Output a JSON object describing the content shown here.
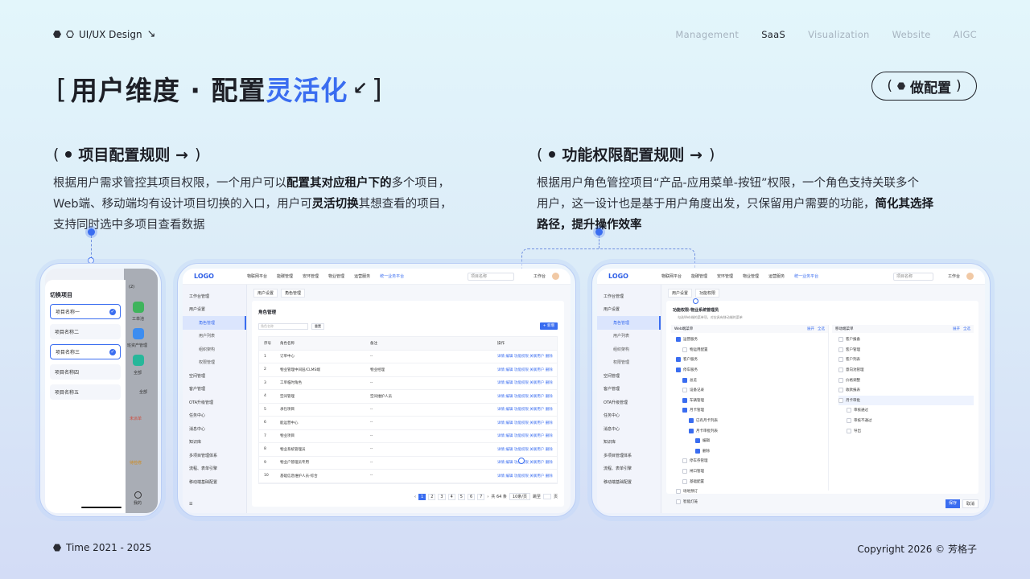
{
  "header": {
    "brand": "UI/UX Design",
    "brand_arrow": "↘",
    "nav": [
      "Management",
      "SaaS",
      "Visualization",
      "Website",
      "AIGC"
    ],
    "nav_active": "SaaS"
  },
  "title": {
    "part1": "用户维度 · 配置",
    "highlight": "灵活化",
    "bracket_left": "[",
    "bracket_right": "]",
    "corner_arrow": "↙"
  },
  "config_button": {
    "label": "做配置"
  },
  "section_left": {
    "heading": "项目配置规则 →",
    "p1_a": "根据用户需求管控其项目权限，一个用户可以",
    "p1_b": "配置其对应租户下的",
    "p1_c": "多个项目，",
    "p2_a": "Web端、移动端均有设计项目切换的入口，用户可",
    "p2_b": "灵活切换",
    "p2_c": "其想查看的项目，",
    "p3": "支持同时选中多项目查看数据"
  },
  "section_right": {
    "heading": "功能权限配置规则 →",
    "p1": "根据用户角色管控项目“产品-应用菜单-按钮”权限，一个角色支持关联多个",
    "p2_a": "用户，这一设计也是基于用户角度出发，只保留用户需要的功能，",
    "p2_b": "简化其选择",
    "p3": "路径",
    "p3_b": "，提升操作效率"
  },
  "phone": {
    "title": "切换项目",
    "items": [
      "项目名称一",
      "项目名称二",
      "项目名称三",
      "项目名称四",
      "项目名称五"
    ],
    "checked": [
      true,
      false,
      true,
      false,
      false
    ],
    "side_labels": [
      "工单池",
      "班资产管理",
      "全部",
      "全部",
      "未派单",
      "待检修",
      "我的"
    ],
    "status_time": "(2)"
  },
  "web1": {
    "logo": "LOGO",
    "tabs": [
      "物联网平台",
      "能碳管理",
      "安环管理",
      "物业管理",
      "运营服务",
      "统一业务平台"
    ],
    "search_placeholder": "项目名称",
    "user": "工作台",
    "sidebar": [
      "工作台管理",
      "用户设置",
      "角色管理",
      "用户列表",
      "组织架构",
      "权限管理",
      "空间管理",
      "客户管理",
      "OTA升级管理",
      "任务中心",
      "消息中心",
      "知识库",
      "多项目管理体系",
      "流程、表单引擎",
      "移动端基础配置"
    ],
    "page_tabs": [
      "用户设置",
      "角色管理"
    ],
    "panel_title": "角色管理",
    "query_placeholder": "角色名称",
    "reset": "重置",
    "add": "+ 新增",
    "columns": [
      "序号",
      "角色名称",
      "备注",
      "操作"
    ],
    "rows": [
      [
        "1",
        "订单中心",
        "--"
      ],
      [
        "2",
        "物业管理中间层/CLMS端",
        "物业经理"
      ],
      [
        "3",
        "工单临时角色",
        "--"
      ],
      [
        "4",
        "空间管理",
        "空间维护人员"
      ],
      [
        "5",
        "承包项目",
        "--"
      ],
      [
        "6",
        "能运营中心",
        "--"
      ],
      [
        "7",
        "物业项目",
        "--"
      ],
      [
        "8",
        "物业系统管理员",
        "--"
      ],
      [
        "9",
        "物业户管理员专用",
        "--"
      ],
      [
        "10",
        "基础信息维护人员-综合",
        "--"
      ]
    ],
    "ops": "详情  编辑  功能权限  关联用户  删除",
    "pages": [
      "1",
      "2",
      "3",
      "4",
      "5",
      "6",
      "7"
    ],
    "total": "共 64 条",
    "per_page": "10条/页",
    "jump": "跳至",
    "jump_page": "页"
  },
  "web2": {
    "page_tabs": [
      "用户设置",
      "功能权限"
    ],
    "panel_title": "功能权限-物业系统管理员",
    "hint": "勾选Web端的菜单项，对应具有移动端的菜单",
    "left_title": "Web端菜单",
    "right_title": "移动端菜单",
    "expand": "展开",
    "select_all": "全选",
    "tree": [
      "运营服务",
      "物运用配置",
      "客户服务",
      "停车服务",
      "总览",
      "设备记录",
      "车辆管理",
      "月卡管理",
      "已有月卡列表",
      "月卡审批列表",
      "编辑",
      "删除",
      "停车券管理",
      "闸口管理",
      "基础配置",
      "场地预订",
      "智能灯笼"
    ],
    "mobile_tree": [
      "客户报备",
      "客户管理",
      "客户列表",
      "意向池管理",
      "价格调整",
      "收款报表",
      "月卡审批",
      "审核通过",
      "审核不通过",
      "导出"
    ],
    "save": "保存",
    "cancel": "取消"
  },
  "footer": {
    "time": "Time 2021 - 2025",
    "copyright": "Copyright 2026 © 芳格子"
  },
  "colors": {
    "accent": "#3a6df0",
    "text": "#1d1f26"
  }
}
